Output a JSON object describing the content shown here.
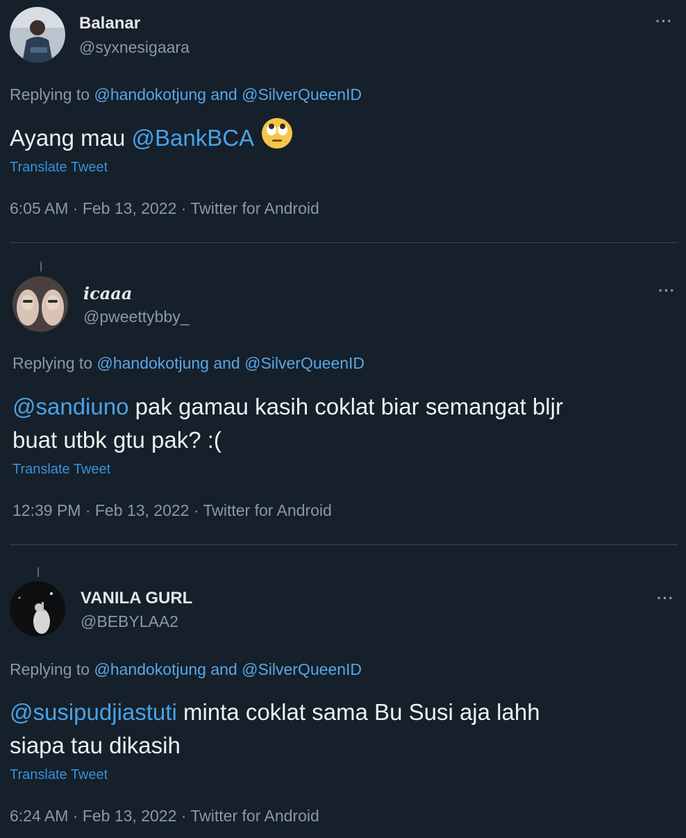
{
  "tweets": [
    {
      "name": "Balanar",
      "handle": "@syxnesigaara",
      "reply_prefix": "Replying to",
      "reply_user1": "@handokotjung",
      "reply_and": "and",
      "reply_user2": "@SilverQueenID",
      "text_prefix": "Ayang mau ",
      "mention": "@BankBCA",
      "text_suffix": "",
      "line2": "",
      "emoji": "rolling-eyes-emoji",
      "translate": "Translate Tweet",
      "meta": "6:05 AM · Feb 13, 2022 · Twitter for Android",
      "more": "···"
    },
    {
      "name": "icaaa",
      "handle": "@pweettybby_",
      "reply_prefix": "Replying to",
      "reply_user1": "@handokotjung",
      "reply_and": "and",
      "reply_user2": "@SilverQueenID",
      "mention": "@sandiuno",
      "text_suffix": " pak gamau kasih coklat biar semangat bljr",
      "line2": "buat utbk gtu pak? :(",
      "translate": "Translate Tweet",
      "meta": "12:39 PM · Feb 13, 2022 · Twitter for Android",
      "more": "···"
    },
    {
      "name": "VANILA GURL",
      "handle": "@BEBYLAA2",
      "reply_prefix": "Replying to",
      "reply_user1": "@handokotjung",
      "reply_and": "and",
      "reply_user2": "@SilverQueenID",
      "mention": "@susipudjiastuti",
      "text_suffix": " minta coklat sama Bu Susi aja lahh",
      "line2": "siapa tau dikasih",
      "translate": "Translate Tweet",
      "meta": "6:24 AM · Feb 13, 2022 · Twitter for Android",
      "more": "···"
    }
  ],
  "colors": {
    "background": "#15202b",
    "link": "#4aa2e6",
    "secondary_text": "#8b98a5",
    "divider": "#38444d"
  }
}
